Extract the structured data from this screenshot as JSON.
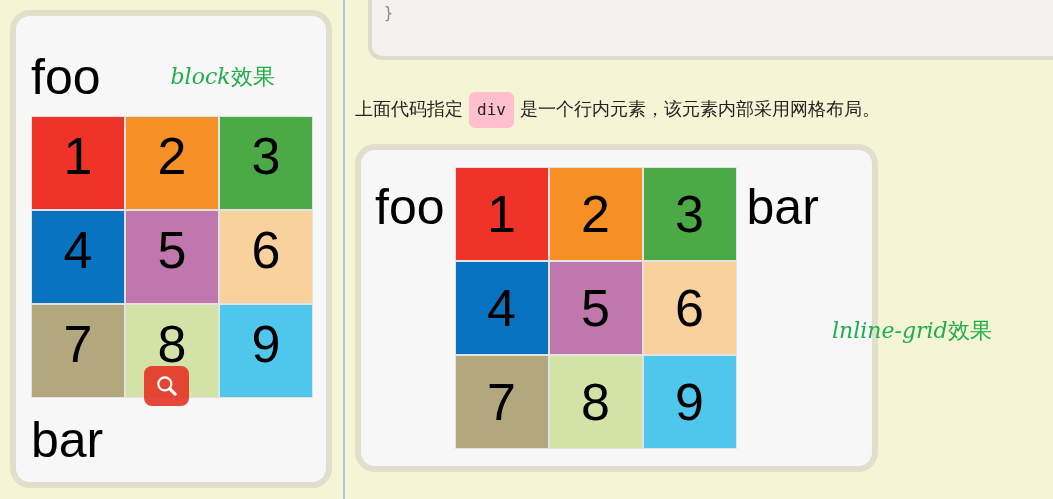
{
  "code_block": {
    "closing": "}"
  },
  "demos": [
    {
      "kind": "block",
      "before": "foo",
      "after": "bar",
      "caption_term": "block",
      "caption_suffix": "效果",
      "search_overlay": true,
      "cells": [
        {
          "label": "1",
          "color": "#ef3328"
        },
        {
          "label": "2",
          "color": "#f68f26"
        },
        {
          "label": "3",
          "color": "#4ba946"
        },
        {
          "label": "4",
          "color": "#0874c1"
        },
        {
          "label": "5",
          "color": "#bf77ae"
        },
        {
          "label": "6",
          "color": "#f8d19d"
        },
        {
          "label": "7",
          "color": "#b3a77d"
        },
        {
          "label": "8",
          "color": "#d3e3a8"
        },
        {
          "label": "9",
          "color": "#4fc7ec"
        }
      ]
    },
    {
      "kind": "inline",
      "before": "foo",
      "after": "bar",
      "caption_term": "lnline-grid",
      "caption_suffix": "效果",
      "cells": [
        {
          "label": "1",
          "color": "#ef3328"
        },
        {
          "label": "2",
          "color": "#f68f26"
        },
        {
          "label": "3",
          "color": "#4ba946"
        },
        {
          "label": "4",
          "color": "#0874c1"
        },
        {
          "label": "5",
          "color": "#bf77ae"
        },
        {
          "label": "6",
          "color": "#f8d19d"
        },
        {
          "label": "7",
          "color": "#b3a77d"
        },
        {
          "label": "8",
          "color": "#d3e3a8"
        },
        {
          "label": "9",
          "color": "#4fc7ec"
        }
      ]
    }
  ],
  "paragraph": {
    "before": "上面代码指定",
    "code": "div",
    "after": "是一个行内元素，该元素内部采用网格布局。"
  }
}
